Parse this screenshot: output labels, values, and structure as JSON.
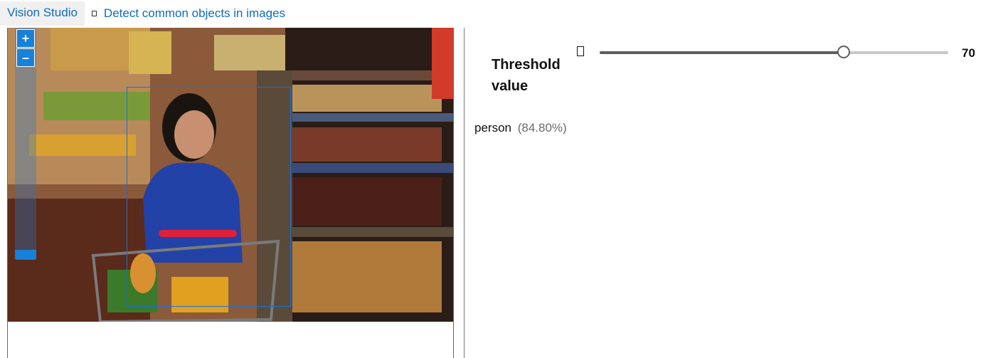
{
  "breadcrumb": {
    "root": "Vision Studio",
    "current": "Detect common objects in images"
  },
  "viewer": {
    "zoom_in_label": "+",
    "zoom_out_label": "–"
  },
  "threshold": {
    "label": "Threshold value",
    "value": "70",
    "fraction": 0.7
  },
  "detections": [
    {
      "label": "person",
      "confidence": "(84.80%)"
    }
  ],
  "colors": {
    "link": "#0f6cbd",
    "detect_box": "#1e6fd0",
    "zoom_control": "#1681d8"
  }
}
